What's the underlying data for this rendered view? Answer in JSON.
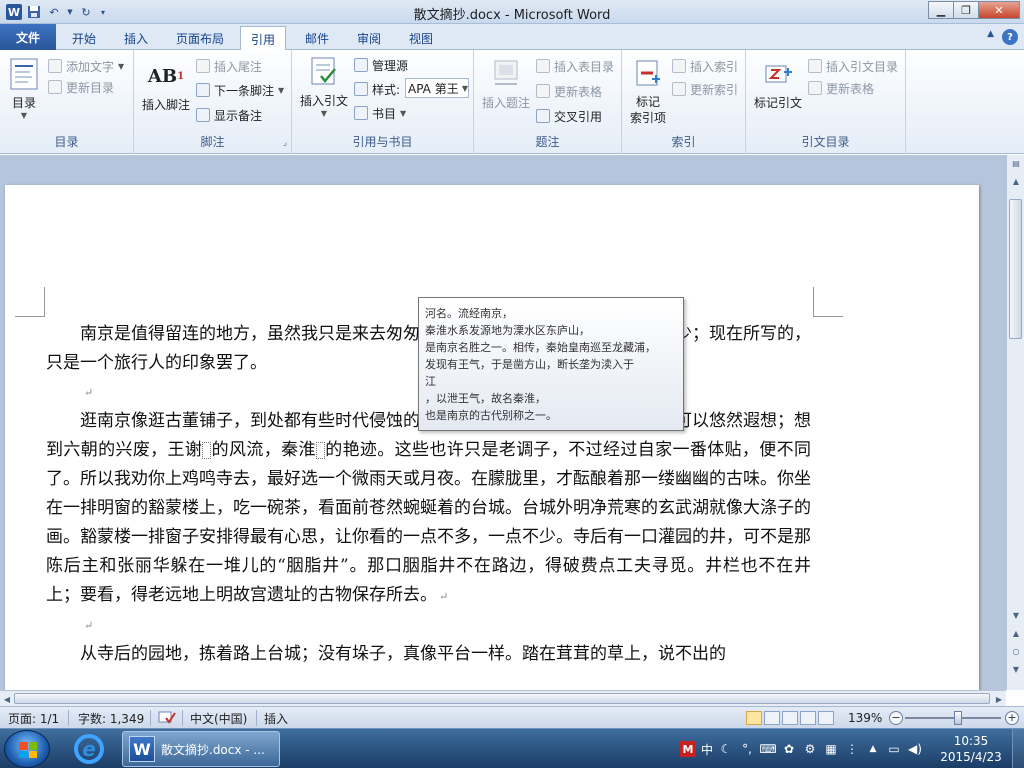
{
  "window": {
    "title": "散文摘抄.docx - Microsoft Word"
  },
  "tabs": [
    {
      "label": "文件"
    },
    {
      "label": "开始"
    },
    {
      "label": "插入"
    },
    {
      "label": "页面布局"
    },
    {
      "label": "引用"
    },
    {
      "label": "邮件"
    },
    {
      "label": "审阅"
    },
    {
      "label": "视图"
    }
  ],
  "ribbon": {
    "toc": {
      "group": "目录",
      "toc_button": "目录",
      "add_text": "添加文字",
      "update_toc": "更新目录"
    },
    "footnotes": {
      "group": "脚注",
      "insert_footnote": "插入脚注",
      "insert_endnote": "插入尾注",
      "next_footnote": "下一条脚注",
      "show_notes": "显示备注"
    },
    "citations": {
      "group": "引用与书目",
      "insert_citation": "插入引文",
      "manage_sources": "管理源",
      "style_label": "样式:",
      "style_value": "APA 第王",
      "bibliography": "书目"
    },
    "captions": {
      "group": "题注",
      "insert_caption": "插入题注",
      "insert_table_of_figures": "插入表目录",
      "update_table": "更新表格",
      "cross_reference": "交叉引用"
    },
    "index": {
      "group": "索引",
      "mark_entry": "标记\n索引项",
      "insert_index": "插入索引",
      "update_index": "更新索引"
    },
    "toa": {
      "group": "引文目录",
      "mark_citation": "标记引文",
      "insert_toa": "插入引文目录",
      "update_table": "更新表格"
    }
  },
  "document": {
    "p1": "南京是值得留连的地方，虽然我只是来去匆匆，但也想夸说夸说，可惜知道的太少；现在所写的，只是一个旅行人的印象罢了。",
    "p2a": "逛南京像逛古董铺子，到处都有些时代侵蚀的痕迹。你可以揣摩，你可以凭吊，可以悠然遐想；想到六朝的兴废，王谢",
    "p2b": "的风流，秦淮",
    "p2c": "的艳迹。这些也许只是老调子，不过经过自家一番体贴，便不同了。所以我劝你上鸡鸣寺去，最好选一个微雨天或月夜。在朦胧里，才酝酿着那一缕幽幽的古味。你坐在一排明窗的豁蒙楼上，吃一碗茶，看面前苍然蜿蜒着的台城。台城外明净荒寒的玄武湖就像大涤子的画。豁蒙楼一排窗子安排得最有心思，让你看的一点不多，一点不少。寺后有一口灌园的井，可不是那陈后主和张丽华躲在一堆儿的“胭脂井”。那口胭脂井不在路边，得破费点工夫寻觅。井栏也不在井上；要看，得老远地上明故宫遗址的古物保存所去。",
    "p3": "从寺后的园地，拣着路上台城；没有垛子，真像平台一样。踏在茸茸的草上，说不出的",
    "para_mark": "↵"
  },
  "tooltip": {
    "lines": [
      "河名。流经南京，",
      "秦淮水系发源地为溧水区东庐山，",
      "是南京名胜之一。相传，秦始皇南巡至龙藏浦，",
      "发现有王气，于是凿方山，断长垄为渎入于",
      "江",
      "，以泄王气，故名秦淮，",
      "也是南京的古代别称之一。"
    ]
  },
  "statusbar": {
    "page": "页面: 1/1",
    "words": "字数: 1,349",
    "language": "中文(中国)",
    "mode": "插入",
    "zoom": "139%"
  },
  "taskbar": {
    "word_task": "散文摘抄.docx - ...",
    "ime": "中",
    "time": "10:35",
    "date": "2015/4/23"
  }
}
